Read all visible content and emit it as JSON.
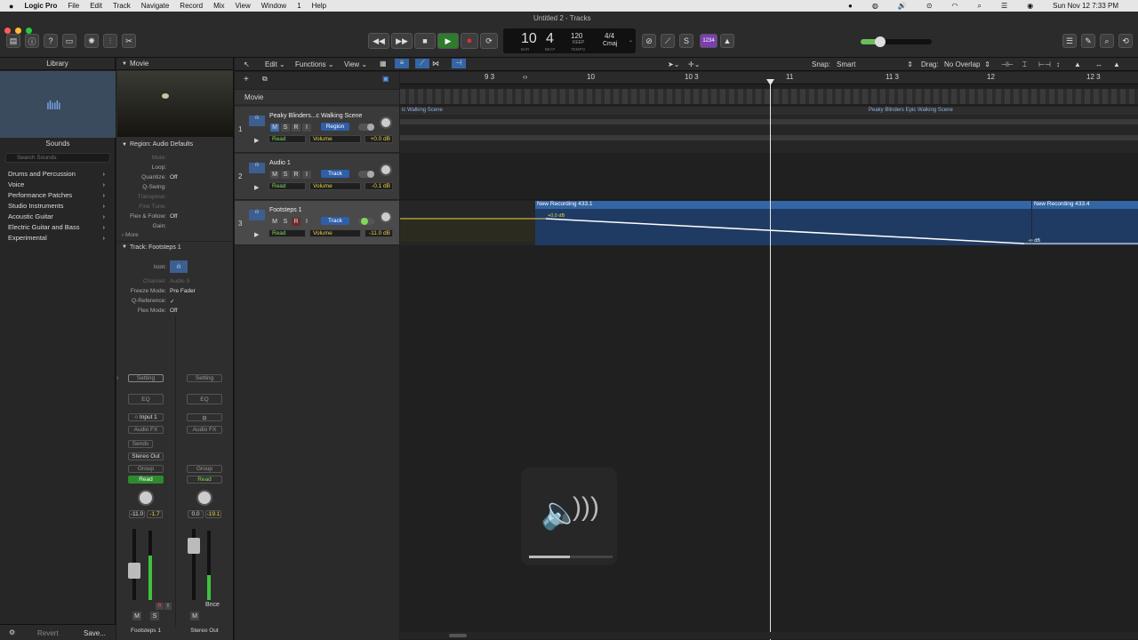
{
  "menubar": {
    "apple": "",
    "app": "Logic Pro",
    "items": [
      "File",
      "Edit",
      "Track",
      "Navigate",
      "Record",
      "Mix",
      "View",
      "Window",
      "1",
      "Help"
    ],
    "datetime": "Sun Nov 12  7:33 PM"
  },
  "window": {
    "title": "Untitled 2 - Tracks"
  },
  "lcd": {
    "bar": "10",
    "beat": "4",
    "bar_label": "BAR",
    "beat_label": "BEAT",
    "tempo": "120",
    "tempo_mode": "KEEP",
    "tempo_label": "TEMPO",
    "signature": "4/4",
    "key": "Cmaj"
  },
  "toolbar": {
    "count_in": "1234"
  },
  "library": {
    "header": "Library",
    "sounds_label": "Sounds",
    "search_placeholder": "Search Sounds",
    "items": [
      "Drums and Percussion",
      "Voice",
      "Performance Patches",
      "Studio Instruments",
      "Acoustic Guitar",
      "Electric Guitar and Bass",
      "Experimental"
    ],
    "revert": "Revert",
    "save": "Save..."
  },
  "inspector": {
    "movie_header": "Movie",
    "region_header": "Region: Audio Defaults",
    "region_rows": [
      [
        "Mute:",
        ""
      ],
      [
        "Loop:",
        ""
      ],
      [
        "Quantize:",
        "Off"
      ],
      [
        "Q-Swing:",
        ""
      ],
      [
        "Transpose:",
        ""
      ],
      [
        "Fine Tune:",
        ""
      ],
      [
        "Flex & Follow:",
        "Off"
      ],
      [
        "Gain:",
        ""
      ]
    ],
    "more": "More",
    "track_header": "Track:  Footsteps 1",
    "icon_label": "Icon:",
    "track_rows": [
      [
        "Channel:",
        "Audio 3"
      ],
      [
        "Freeze Mode:",
        "Pre Fader"
      ],
      [
        "Q-Reference:",
        "✓"
      ],
      [
        "Flex Mode:",
        "Off"
      ]
    ]
  },
  "strip1": {
    "setting": "Setting",
    "eq": "EQ",
    "input": "Input 1",
    "audio_fx": "Audio FX",
    "sends": "Sends",
    "output": "Stereo Out",
    "group": "Group",
    "automation": "Read",
    "vol": "-11.0",
    "peak": "-1.7",
    "mute": "M",
    "solo": "S",
    "name": "Footsteps 1",
    "rec": "R",
    "in": "I"
  },
  "strip2": {
    "setting": "Setting",
    "eq": "EQ",
    "audio_fx": "Audio FX",
    "group": "Group",
    "automation": "Read",
    "vol": "0.0",
    "peak": "-19.1",
    "mute": "M",
    "bounce": "Bnce",
    "name": "Stereo Out"
  },
  "tracks_toolbar": {
    "edit": "Edit",
    "functions": "Functions",
    "view": "View",
    "snap_label": "Snap:",
    "snap": "Smart",
    "drag_label": "Drag:",
    "drag": "No Overlap"
  },
  "ruler": {
    "marks": [
      "9 3",
      "10",
      "10 3",
      "11",
      "11 3",
      "12",
      "12 3"
    ]
  },
  "movie_track": "Movie",
  "tracks": [
    {
      "num": "1",
      "name": "Peaky Blinders...c Walking Scene",
      "mode": "Region",
      "automation": "Read",
      "param": "Volume",
      "value": "+0.0 dB",
      "m": "M",
      "s": "S",
      "r": "R",
      "i": "I"
    },
    {
      "num": "2",
      "name": "Audio 1",
      "mode": "Track",
      "automation": "Read",
      "param": "Volume",
      "value": "-0.1 dB",
      "m": "M",
      "s": "S",
      "r": "R",
      "i": "I"
    },
    {
      "num": "3",
      "name": "Footsteps 1",
      "mode": "Track",
      "automation": "Read",
      "param": "Volume",
      "value": "-11.0 dB",
      "m": "M",
      "s": "S",
      "r": "R",
      "i": "I"
    }
  ],
  "regions": {
    "walk_left": "ic Walking Scene",
    "walk_right": "Peaky Blinders Epic Walking Scene",
    "rec1": "New Recording 433.1",
    "rec2": "New Recording 433.4",
    "auto_start": "+0.0 dB",
    "auto_end": "-∞ dB"
  }
}
